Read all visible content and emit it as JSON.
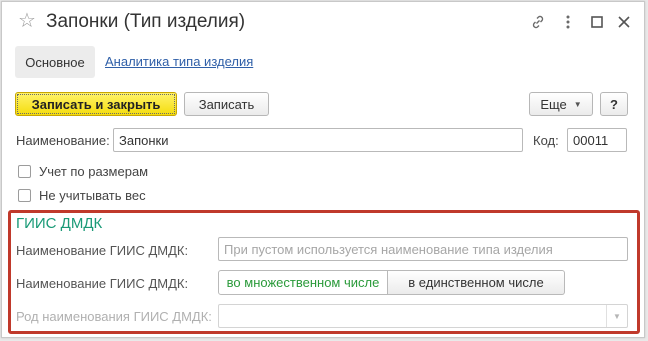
{
  "window": {
    "title": "Запонки (Тип изделия)"
  },
  "tabs": [
    {
      "label": "Основное"
    },
    {
      "label": "Аналитика типа изделия"
    }
  ],
  "toolbar": {
    "save_close_label": "Записать и закрыть",
    "save_label": "Записать",
    "more_label": "Еще",
    "help_label": "?"
  },
  "form": {
    "name_label": "Наименование:",
    "name_value": "Запонки",
    "code_label": "Код:",
    "code_value": "00011",
    "sizes_checkbox_label": "Учет по размерам",
    "weight_checkbox_label": "Не учитывать вес"
  },
  "giis": {
    "group_title": "ГИИС ДМДК",
    "name_label": "Наименование ГИИС ДМДК:",
    "name_placeholder": "При пустом используется наименование типа изделия",
    "plural_label": "Наименование ГИИС ДМДК:",
    "plural_option": "во множественном числе",
    "singular_option": "в единственном числе",
    "gender_label": "Род наименования ГИИС ДМДК:",
    "gender_value": ""
  },
  "colors": {
    "primary_button": "#f4dc0c",
    "group_border": "#c0392b",
    "group_title": "#1a9a77",
    "link": "#2f5fa8",
    "active_option": "#2a9a3a"
  }
}
